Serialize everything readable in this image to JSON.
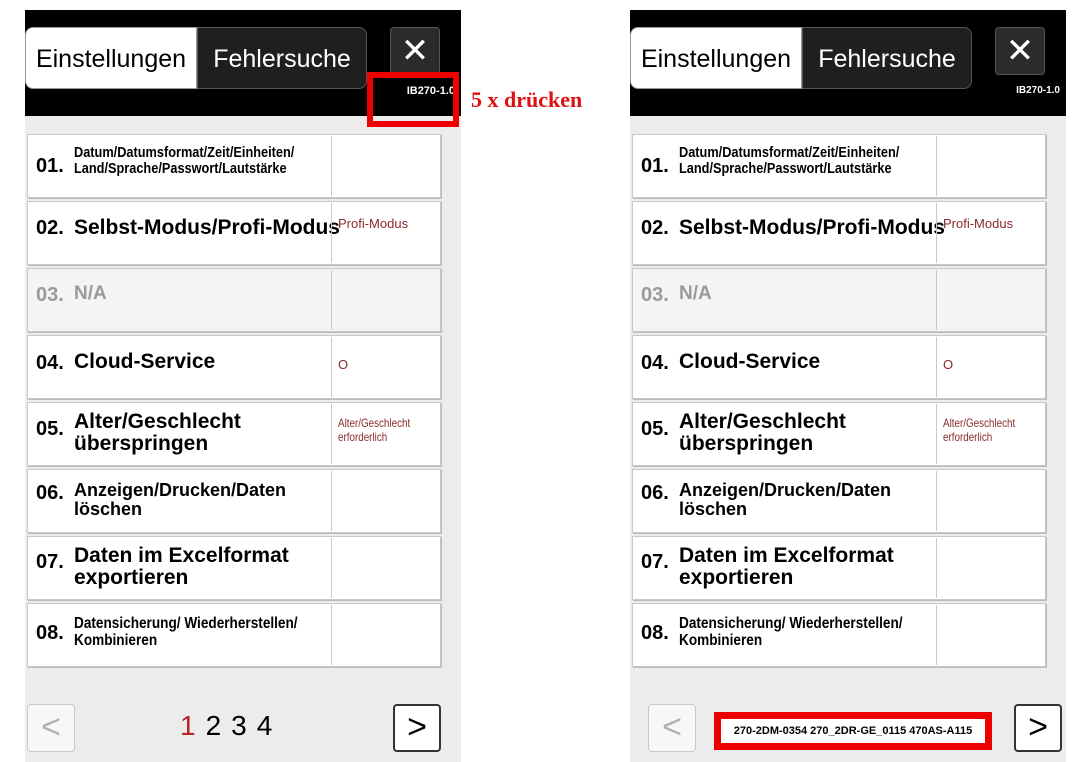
{
  "tabs": {
    "settings": "Einstellungen",
    "troubleshooting": "Fehlersuche"
  },
  "close_icon": "close-icon",
  "version": "IB270-1.0",
  "hint": "5 x drücken",
  "items": [
    {
      "num": "01.",
      "line1": "Datum/Datumsformat/Zeit/Einheiten/",
      "line2": "Land/Sprache/Passwort/Lautstärke",
      "value1": "",
      "value2": ""
    },
    {
      "num": "02.",
      "line1": "Selbst-Modus/Profi-Modus",
      "line2": "",
      "value1": "Profi-Modus",
      "value2": ""
    },
    {
      "num": "03.",
      "line1": "N/A",
      "line2": "",
      "value1": "",
      "value2": ""
    },
    {
      "num": "04.",
      "line1": "Cloud-Service",
      "line2": "",
      "value1": "O",
      "value2": ""
    },
    {
      "num": "05.",
      "line1": "Alter/Geschlecht",
      "line2": "überspringen",
      "value1": "Alter/Geschlecht",
      "value2": "erforderlich"
    },
    {
      "num": "06.",
      "line1": "Anzeigen/Drucken/Daten",
      "line2": "löschen",
      "value1": "",
      "value2": ""
    },
    {
      "num": "07.",
      "line1": "Daten im Excelformat",
      "line2": "exportieren",
      "value1": "",
      "value2": ""
    },
    {
      "num": "08.",
      "line1": "Datensicherung/ Wiederherstellen/",
      "line2": "Kombinieren",
      "value1": "",
      "value2": ""
    }
  ],
  "pagination": {
    "prev": "<",
    "next": ">",
    "current": "1",
    "others": [
      "2",
      "3",
      "4"
    ]
  },
  "serial": "270-2DM-0354 270_2DR-GE_0115 470AS-A115",
  "colors": {
    "highlight": "#e00000",
    "value_text": "#8a2a2a",
    "current_page": "#b22222"
  }
}
